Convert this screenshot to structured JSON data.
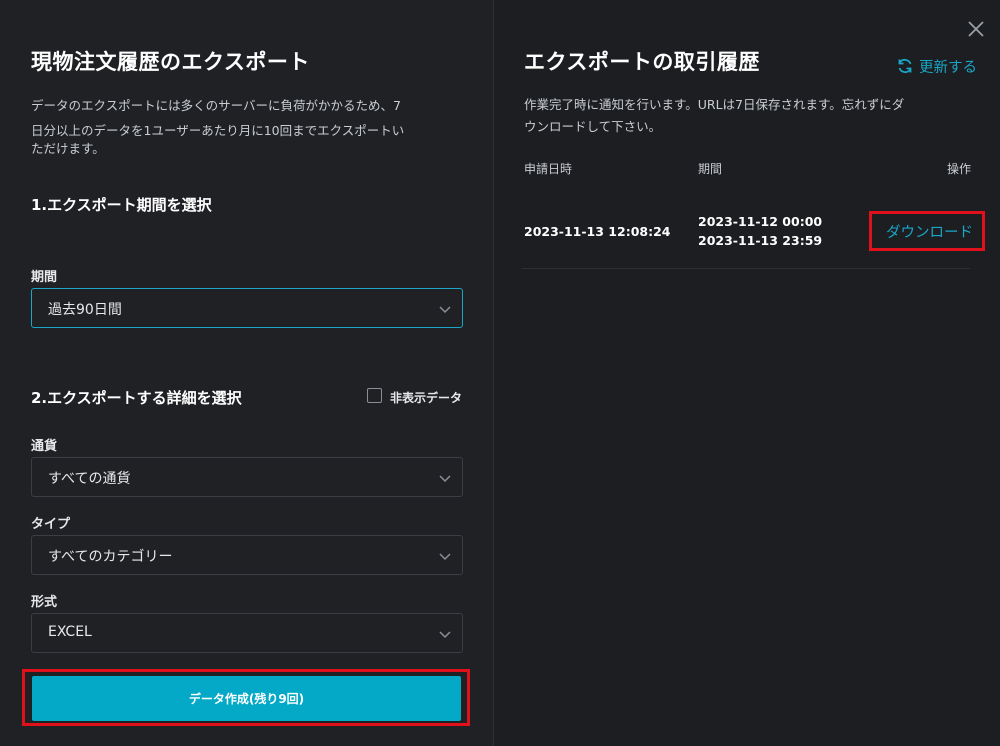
{
  "close_icon": "close-icon",
  "left": {
    "title": "現物注文履歴のエクスポート",
    "description_line1": "データのエクスポートには多くのサーバーに負荷がかかるため、7",
    "description_line2": "日分以上のデータを1ユーザーあたり月に10回までエクスポートい",
    "description_line3": "ただけます。",
    "section1": "1.エクスポート期間を選択",
    "period_label": "期間",
    "period_value": "過去90日間",
    "section2": "2.エクスポートする詳細を選択",
    "hidden_data_label": "非表示データ",
    "currency_label": "通貨",
    "currency_value": "すべての通貨",
    "type_label": "タイプ",
    "type_value": "すべてのカテゴリー",
    "format_label": "形式",
    "format_value": "EXCEL",
    "create_button": "データ作成(残り9回)"
  },
  "right": {
    "title": "エクスポートの取引履歴",
    "refresh_label": "更新する",
    "notice_line1": "作業完了時に通知を行います。URLは7日保存されます。忘れずにダ",
    "notice_line2": "ウンロードして下さい。",
    "columns": {
      "requested_at": "申請日時",
      "period": "期間",
      "action": "操作"
    },
    "rows": [
      {
        "requested_at": "2023-11-13 12:08:24",
        "period_start": "2023-11-12 00:00",
        "period_end": "2023-11-13 23:59",
        "action": "ダウンロード"
      }
    ]
  },
  "colors": {
    "accent": "#04a9c7",
    "highlight": "#e0111a",
    "background": "#1e2024"
  }
}
